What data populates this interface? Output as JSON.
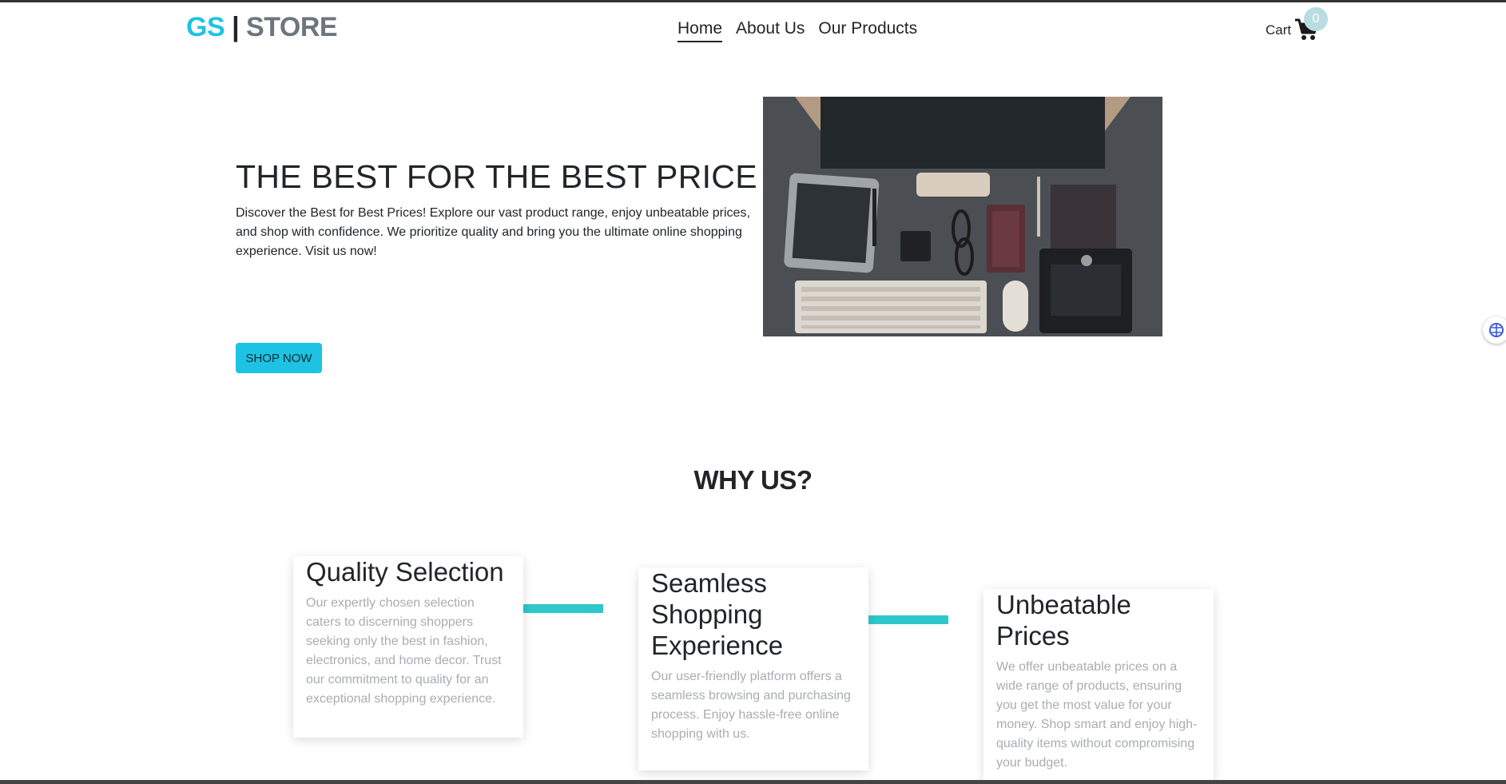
{
  "brand": {
    "gs": "GS",
    "sep": "|",
    "store": "STORE"
  },
  "nav": {
    "home": "Home",
    "about": "About Us",
    "products": "Our Products"
  },
  "cart": {
    "label": "Cart",
    "count": "0"
  },
  "hero": {
    "title": "THE BEST FOR THE BEST PRICE",
    "text": "Discover the Best for Best Prices! Explore our vast product range, enjoy unbeatable prices, and shop with confidence. We prioritize quality and bring you the ultimate online shopping experience. Visit us now!",
    "button": "SHOP NOW"
  },
  "why": {
    "title": "WHY US?",
    "cards": [
      {
        "title": "Quality Selection",
        "text": "Our expertly chosen selection caters to discerning shoppers seeking only the best in fashion, electronics, and home decor. Trust our commitment to quality for an exceptional shopping experience."
      },
      {
        "title": "Seamless Shopping Experience",
        "text": "Our user-friendly platform offers a seamless browsing and purchasing process. Enjoy hassle-free online shopping with us."
      },
      {
        "title": "Unbeatable Prices",
        "text": "We offer unbeatable prices on a wide range of products, ensuring you get the most value for your money. Shop smart and enjoy high-quality items without compromising your budget."
      }
    ]
  },
  "colors": {
    "accent": "#1ec3e3",
    "connector": "#2ec8cb",
    "muted": "#6c757d",
    "badge": "#b9dce1"
  },
  "icons": {
    "cart": "shopping-cart-icon",
    "widget": "brain-icon"
  }
}
